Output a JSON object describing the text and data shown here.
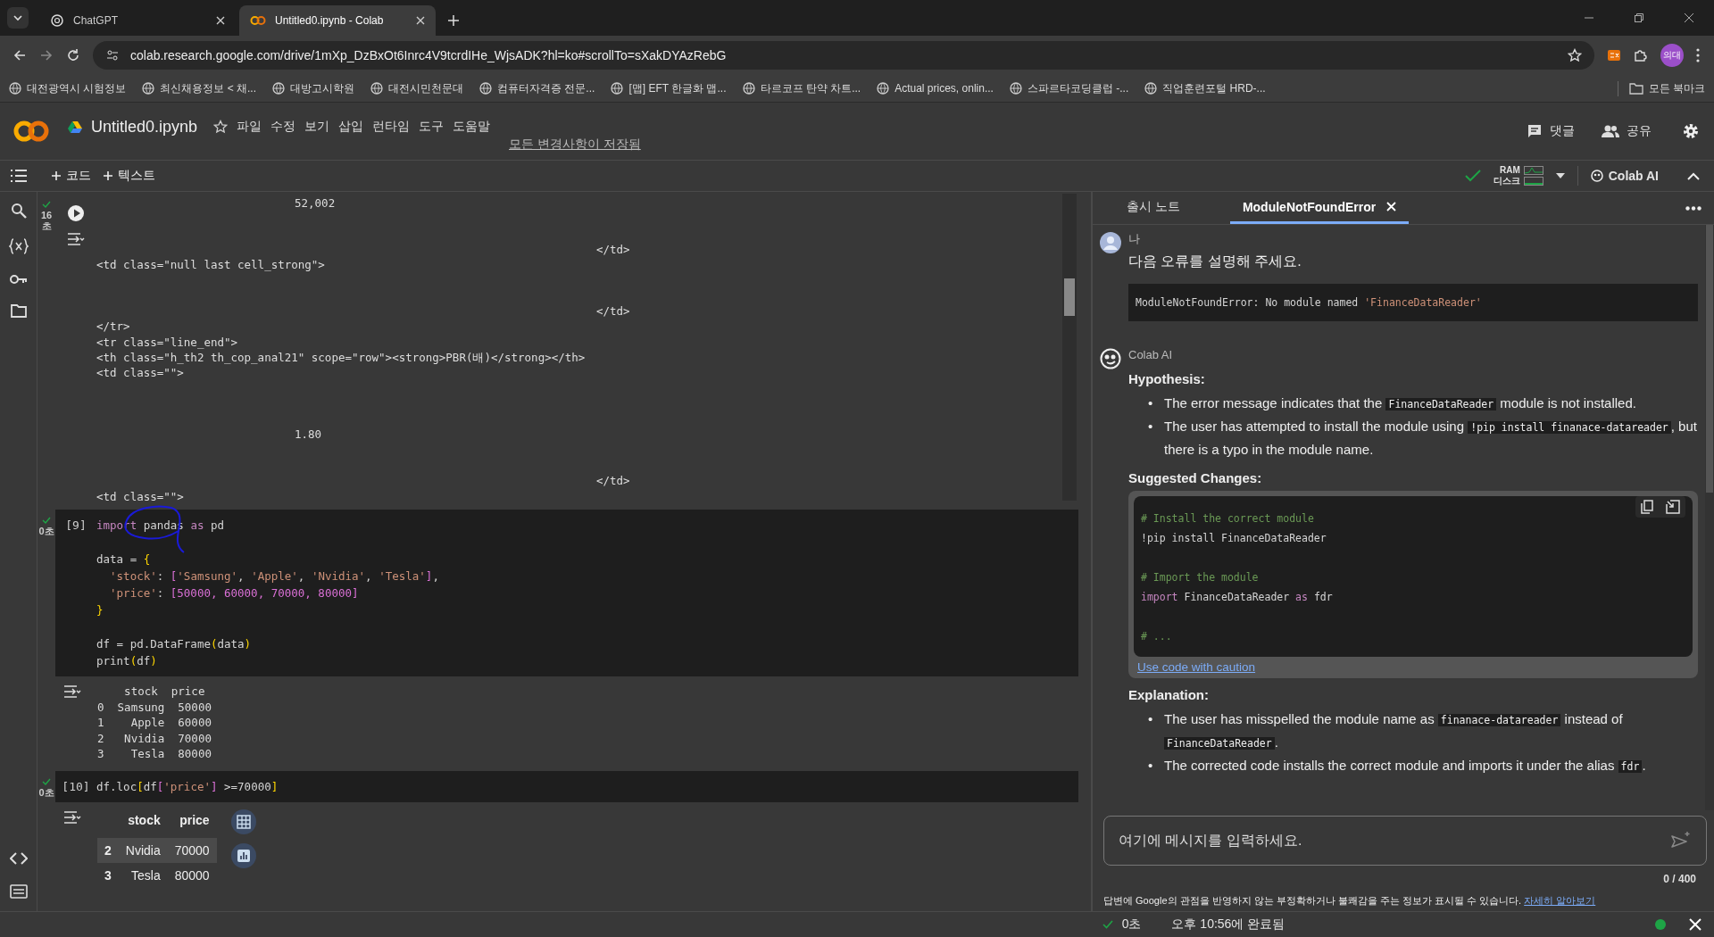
{
  "browser": {
    "tabs": [
      {
        "title": "ChatGPT",
        "selected": false
      },
      {
        "title": "Untitled0.ipynb - Colab",
        "selected": true
      }
    ],
    "url": "colab.research.google.com/drive/1mXp_DzBxOt6Inrc4V9tcrdIHe_WjsADK?hl=ko#scrollTo=sXakDYAzRebG",
    "profile": "의대",
    "bookmarks": [
      "대전광역시 시험정보",
      "최신채용정보 < 채...",
      "대방고시학원",
      "대전시민천문대",
      "컴퓨터자격증 전문...",
      "[맵] EFT 한글화 맵...",
      "타르코프 탄약 차트...",
      "Actual prices, onlin...",
      "스파르타코딩클럽 -...",
      "직업훈련포털 HRD-..."
    ],
    "all_bookmarks": "모든 북마크"
  },
  "colab": {
    "title": "Untitled0.ipynb",
    "menu": [
      "파일",
      "수정",
      "보기",
      "삽입",
      "런타임",
      "도구",
      "도움말"
    ],
    "saved": "모든 변경사항이 저장됨",
    "comment": "댓글",
    "share": "공유",
    "add_code": "코드",
    "add_text": "텍스트",
    "connected": true,
    "ram": "RAM",
    "disk": "디스크",
    "ai_button": "Colab AI"
  },
  "cells": [
    {
      "kind": "output",
      "ok": true,
      "duration": "16 초",
      "lines": [
        {
          "kind": "value",
          "text": "52,002"
        },
        {
          "kind": "blank"
        },
        {
          "kind": "blank"
        },
        {
          "kind": "close",
          "text": "</td>"
        },
        {
          "kind": "tag",
          "text": "<td class=\"null last cell_strong\">"
        },
        {
          "kind": "blank"
        },
        {
          "kind": "blank"
        },
        {
          "kind": "close",
          "text": "</td>"
        },
        {
          "kind": "tag",
          "text": "</tr>"
        },
        {
          "kind": "tag",
          "text": "<tr class=\"line_end\">"
        },
        {
          "kind": "tag",
          "text": "<th class=\"h_th2 th_cop_anal21\" scope=\"row\"><strong>PBR(배)</strong></th>"
        },
        {
          "kind": "tag",
          "text": "<td class=\"\">"
        },
        {
          "kind": "blank"
        },
        {
          "kind": "blank"
        },
        {
          "kind": "blank"
        },
        {
          "kind": "value",
          "text": "1.80"
        },
        {
          "kind": "blank"
        },
        {
          "kind": "blank"
        },
        {
          "kind": "close",
          "text": "</td>"
        },
        {
          "kind": "tag",
          "text": "<td class=\"\">"
        }
      ]
    },
    {
      "kind": "code",
      "ok": true,
      "duration": "0초",
      "count": "[9]",
      "lines": [
        {
          "tokens": [
            {
              "text": "import",
              "kind": "kw"
            },
            {
              "text": " pandas ",
              "kind": "p"
            },
            {
              "text": "as",
              "kind": "kw"
            },
            {
              "text": " pd",
              "kind": "p"
            }
          ]
        },
        {
          "kind": "blank"
        },
        {
          "tokens": [
            {
              "text": "data = ",
              "kind": "p"
            },
            {
              "text": "{",
              "kind": "b1"
            }
          ]
        },
        {
          "tokens": [
            {
              "text": "  'stock'",
              "kind": "str"
            },
            {
              "text": ": ",
              "kind": "p"
            },
            {
              "text": "[",
              "kind": "b2"
            },
            {
              "text": "'Samsung'",
              "kind": "str"
            },
            {
              "text": ", ",
              "kind": "p"
            },
            {
              "text": "'Apple'",
              "kind": "str"
            },
            {
              "text": ", ",
              "kind": "p"
            },
            {
              "text": "'Nvidia'",
              "kind": "str"
            },
            {
              "text": ", ",
              "kind": "p"
            },
            {
              "text": "'Tesla'",
              "kind": "str"
            },
            {
              "text": "]",
              "kind": "b2"
            },
            {
              "text": ",",
              "kind": "p"
            }
          ]
        },
        {
          "tokens": [
            {
              "text": "  'price'",
              "kind": "str"
            },
            {
              "text": ": ",
              "kind": "p"
            },
            {
              "text": "[50000, 60000, 70000, 80000]",
              "kind": "b2"
            }
          ]
        },
        {
          "tokens": [
            {
              "text": "}",
              "kind": "b1"
            }
          ]
        },
        {
          "kind": "blank"
        },
        {
          "tokens": [
            {
              "text": "df = pd.DataFrame",
              "kind": "p"
            },
            {
              "text": "(",
              "kind": "b1"
            },
            {
              "text": "data",
              "kind": "p"
            },
            {
              "text": ")",
              "kind": "b1"
            }
          ]
        },
        {
          "tokens": [
            {
              "text": "print",
              "kind": "p"
            },
            {
              "text": "(",
              "kind": "b1"
            },
            {
              "text": "df",
              "kind": "p"
            },
            {
              "text": ")",
              "kind": "b1"
            }
          ]
        }
      ],
      "output": {
        "kind": "text",
        "lines": [
          "    stock  price",
          "0  Samsung  50000",
          "1    Apple  60000",
          "2   Nvidia  70000",
          "3    Tesla  80000"
        ]
      }
    },
    {
      "kind": "code",
      "ok": true,
      "duration": "0초",
      "count": "[10]",
      "lines": [
        {
          "tokens": [
            {
              "text": "df.loc",
              "kind": "p"
            },
            {
              "text": "[",
              "kind": "b1"
            },
            {
              "text": "df",
              "kind": "p"
            },
            {
              "text": "[",
              "kind": "b2"
            },
            {
              "text": "'price'",
              "kind": "str"
            },
            {
              "text": "]",
              "kind": "b2"
            },
            {
              "text": " >=70000",
              "kind": "p"
            },
            {
              "text": "]",
              "kind": "b1"
            }
          ]
        }
      ],
      "output": {
        "kind": "table",
        "columns": [
          "stock",
          "price"
        ],
        "rows": [
          {
            "index": "2",
            "cells": [
              "Nvidia",
              "70000"
            ],
            "highlighted": true
          },
          {
            "index": "3",
            "cells": [
              "Tesla",
              "80000"
            ],
            "highlighted": false
          }
        ]
      }
    }
  ],
  "panel": {
    "tabs": [
      {
        "label": "출시 노트",
        "selected": false,
        "closable": false
      },
      {
        "label": "ModuleNotFoundError",
        "selected": true,
        "closable": true
      }
    ],
    "user": {
      "name": "나",
      "text": "다음 오류를 설명해 주세요.",
      "code": [
        {
          "text": "ModuleNotFoundError: No module named ",
          "kind": "p"
        },
        {
          "text": "'FinanceDataReader'",
          "kind": "str"
        }
      ]
    },
    "ai": {
      "name": "Colab AI",
      "sections": [
        {
          "kind": "bullets",
          "heading": "Hypothesis:",
          "marker": "•",
          "bullets": [
            [
              {
                "text": "The error message indicates that the ",
                "kind": "text"
              },
              {
                "text": "FinanceDataReader",
                "kind": "code"
              },
              {
                "text": " module is not installed.",
                "kind": "text"
              }
            ],
            [
              {
                "text": "The user has attempted to install the module using ",
                "kind": "text"
              },
              {
                "text": "!pip install finanace-datareader",
                "kind": "code"
              },
              {
                "text": ", but there is a typo in the module name.",
                "kind": "text"
              }
            ]
          ]
        },
        {
          "kind": "code",
          "heading": "Suggested Changes:",
          "lines": [
            {
              "tokens": [
                {
                  "text": "# Install the correct module",
                  "kind": "com"
                }
              ]
            },
            {
              "tokens": [
                {
                  "text": "!pip install FinanceDataReader",
                  "kind": "p"
                }
              ]
            },
            {
              "kind": "blank"
            },
            {
              "tokens": [
                {
                  "text": "# Import the module",
                  "kind": "com"
                }
              ]
            },
            {
              "tokens": [
                {
                  "text": "import",
                  "kind": "kw"
                },
                {
                  "text": " FinanceDataReader ",
                  "kind": "p"
                },
                {
                  "text": "as",
                  "kind": "kw"
                },
                {
                  "text": " fdr",
                  "kind": "p"
                }
              ]
            },
            {
              "kind": "blank"
            },
            {
              "tokens": [
                {
                  "text": "# ...",
                  "kind": "com"
                }
              ]
            }
          ],
          "link": "Use code with caution"
        },
        {
          "kind": "bullets",
          "heading": "Explanation:",
          "marker": "•",
          "bullets": [
            [
              {
                "text": "The user has misspelled the module name as ",
                "kind": "text"
              },
              {
                "text": "finanace-datareader",
                "kind": "code"
              },
              {
                "text": " instead of ",
                "kind": "text"
              },
              {
                "text": "FinanceDataReader",
                "kind": "code"
              },
              {
                "text": ".",
                "kind": "text"
              }
            ],
            [
              {
                "text": "The corrected code installs the correct module and imports it under the alias ",
                "kind": "text"
              },
              {
                "text": "fdr",
                "kind": "code"
              },
              {
                "text": ".",
                "kind": "text"
              }
            ]
          ]
        }
      ]
    },
    "input": {
      "placeholder": "여기에 메시지를 입력하세요.",
      "counter": "0 / 400"
    },
    "disclaimer": "답변에 Google의 관점을 반영하지 않는 부정확하거나 불쾌감을 주는 정보가 표시될 수 있습니다.",
    "learn_more": "자세히 알아보기"
  },
  "status": {
    "ok": true,
    "duration": "0초",
    "completed": "오후 10:56에 완료됨",
    "connected": true
  }
}
